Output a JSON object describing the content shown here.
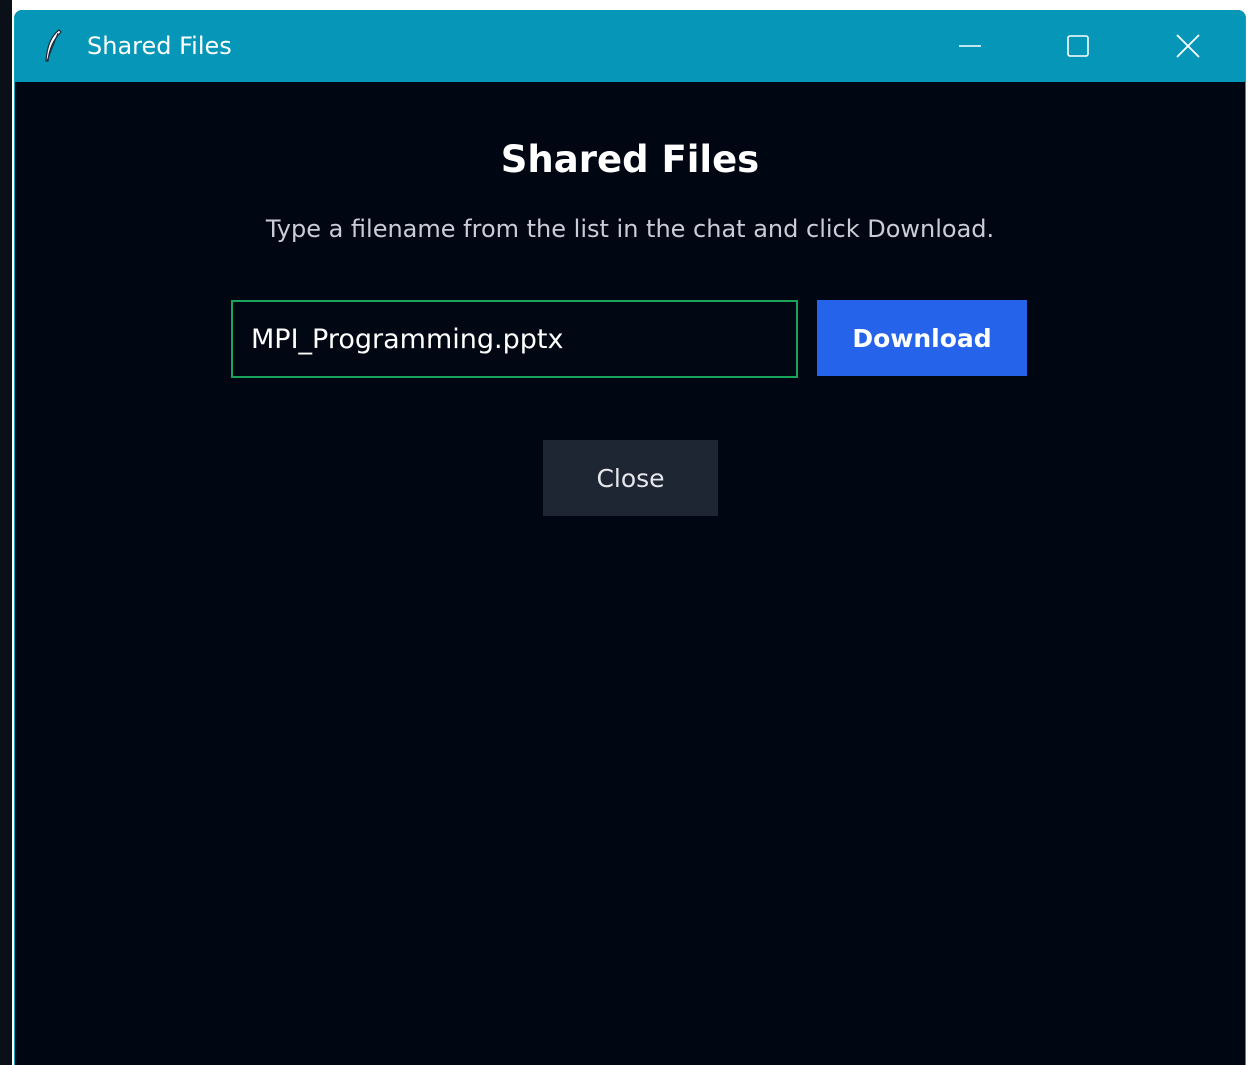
{
  "window": {
    "title": "Shared Files",
    "icon": "feather-icon",
    "controls": {
      "minimize_icon": "minimize-icon",
      "maximize_icon": "maximize-icon",
      "close_icon": "close-icon"
    },
    "titlebar_color": "#0596b8",
    "background_color": "#010613"
  },
  "dialog": {
    "heading": "Shared Files",
    "instruction": "Type a filename from the list in the chat and click Download.",
    "filename_input": {
      "value": "MPI_Programming.pptx",
      "border_color": "#19a35b"
    },
    "download_label": "Download",
    "download_color": "#2563eb",
    "close_label": "Close"
  }
}
